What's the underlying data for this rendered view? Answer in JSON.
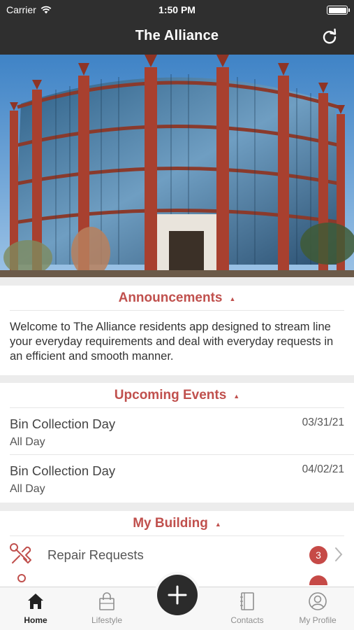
{
  "status_bar": {
    "carrier": "Carrier",
    "time": "1:50 PM"
  },
  "nav": {
    "title": "The Alliance",
    "refresh_icon": "refresh-icon"
  },
  "hero": {
    "description_icon": "building-photo"
  },
  "announcements": {
    "title": "Announcements",
    "text": "Welcome to The Alliance residents app designed to stream line your everyday requirements and deal with everyday requests in an efficient and smooth manner."
  },
  "events": {
    "title": "Upcoming Events",
    "items": [
      {
        "title": "Bin Collection Day",
        "subtitle": "All Day",
        "date": "03/31/21"
      },
      {
        "title": "Bin Collection Day",
        "subtitle": "All Day",
        "date": "04/02/21"
      }
    ]
  },
  "my_building": {
    "title": "My Building",
    "items": [
      {
        "label": "Repair Requests",
        "badge": "3",
        "icon": "repair-tools-icon"
      }
    ]
  },
  "tabbar": {
    "items": [
      {
        "label": "Home",
        "icon": "home-icon",
        "active": true
      },
      {
        "label": "Lifestyle",
        "icon": "shopping-bag-icon",
        "active": false
      },
      {
        "label": "Contacts",
        "icon": "address-book-icon",
        "active": false
      },
      {
        "label": "My Profile",
        "icon": "profile-icon",
        "active": false
      }
    ],
    "fab_icon": "plus-icon"
  },
  "colors": {
    "accent": "#c0504d",
    "topbar": "#2f2f2f",
    "badge": "#c64a47"
  }
}
